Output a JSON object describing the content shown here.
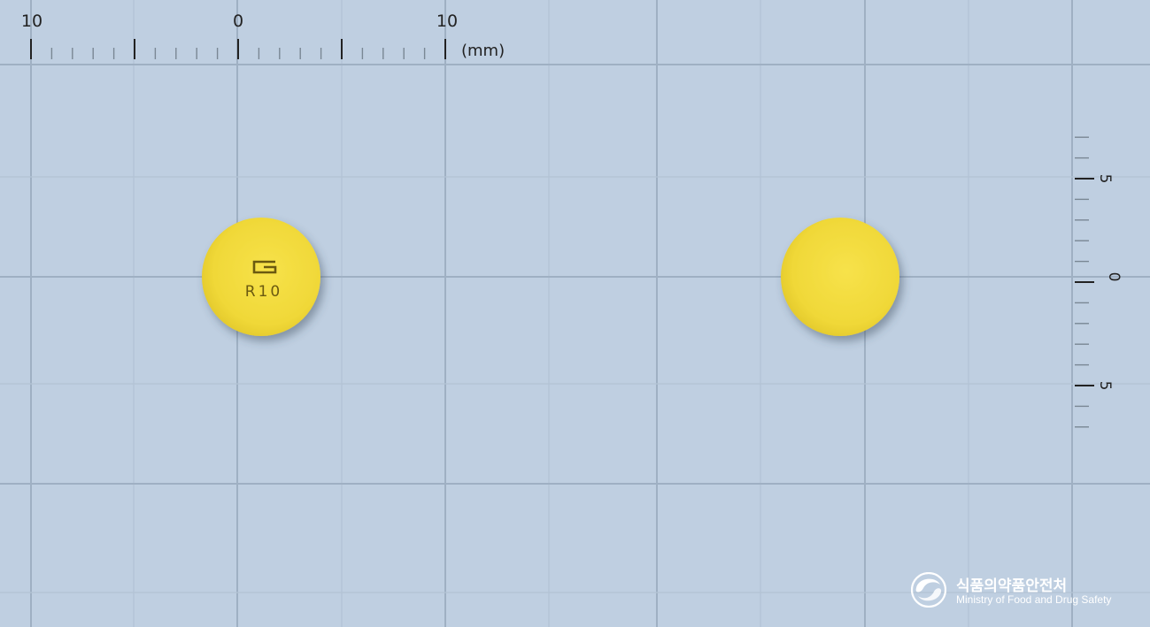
{
  "ruler_top": {
    "labels": [
      "10",
      "0",
      "10"
    ],
    "unit": "(mm)"
  },
  "ruler_right": {
    "labels": [
      "5",
      "0",
      "5"
    ]
  },
  "tablets": [
    {
      "side": "front",
      "imprint_logo": "G",
      "imprint_text": "R10",
      "color": "#f2dc3a"
    },
    {
      "side": "back",
      "imprint_text": "",
      "color": "#f2dc3a"
    }
  ],
  "watermark": {
    "org_korean": "식품의약품안전처",
    "org_english": "Ministry of Food and Drug Safety"
  },
  "colors": {
    "background": "#bfcfe1",
    "grid_major": "#9fb0c3",
    "grid_minor": "#b2c2d4",
    "ruler_ink": "#222222",
    "tablet": "#f2dc3a",
    "imprint": "#6b5a10"
  }
}
